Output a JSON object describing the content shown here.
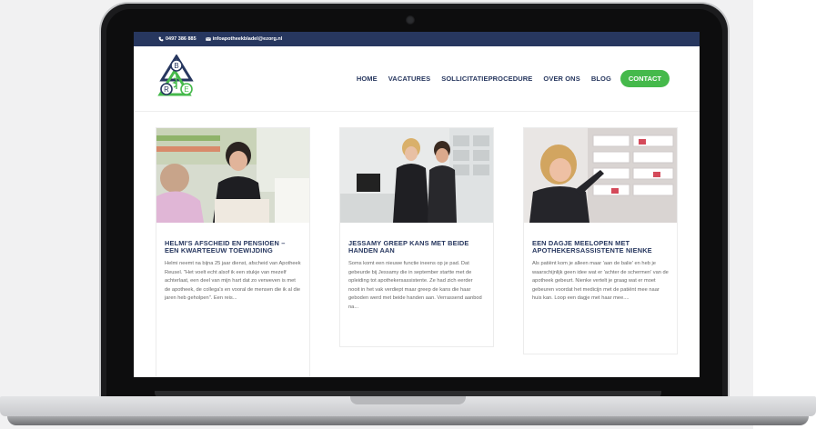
{
  "topbar": {
    "phone": "0497 386 885",
    "email": "infoapotheekbladel@ezorg.nl"
  },
  "logo": {
    "letters": [
      "B",
      "R",
      "E"
    ]
  },
  "nav": {
    "items": [
      "HOME",
      "VACATURES",
      "SOLLICITATIEPROCEDURE",
      "OVER ONS",
      "BLOG"
    ],
    "cta": "CONTACT"
  },
  "posts": [
    {
      "title": "HELMI'S AFSCHEID EN PENSIOEN – EEN KWARTEEUW TOEWIJDING",
      "excerpt": "Helmi neemt na bijna 25 jaar dienst, afscheid van Apotheek Reusel. \"Het voelt echt alsof ik een stukje van mezelf achterlaat, een deel van mijn hart dat zo verweven is met de apotheek, de collega's en vooral de mensen die ik al die jaren heb geholpen\".  Een reis..."
    },
    {
      "title": "JESSAMY GREEP KANS MET BEIDE HANDEN AAN",
      "excerpt": "Soms komt een nieuwe functie ineens op je pad. Dat gebeurde bij Jessamy die in september startte met de opleiding tot apothekersassistente. Ze had zich eerder nooit in het vak verdiept maar greep de kans die haar geboden werd met beide handen aan. Verrassend aanbod na..."
    },
    {
      "title": "EEN DAGJE MEELOPEN MET APOTHEKERSASSISTENTE NIENKE",
      "excerpt": "Als patiënt kom je alleen maar 'aan de balie' en heb je waarschijnlijk geen idee wat er 'achter de schermen' van de apotheek gebeurt. Nienke vertelt je graag wat er moet gebeuren voordat het medicijn met de patiënt mee naar huis kan. Loop een dagje met haar mee...."
    }
  ],
  "colors": {
    "navy": "#27375f",
    "green": "#45b94b",
    "text": "#666666"
  }
}
